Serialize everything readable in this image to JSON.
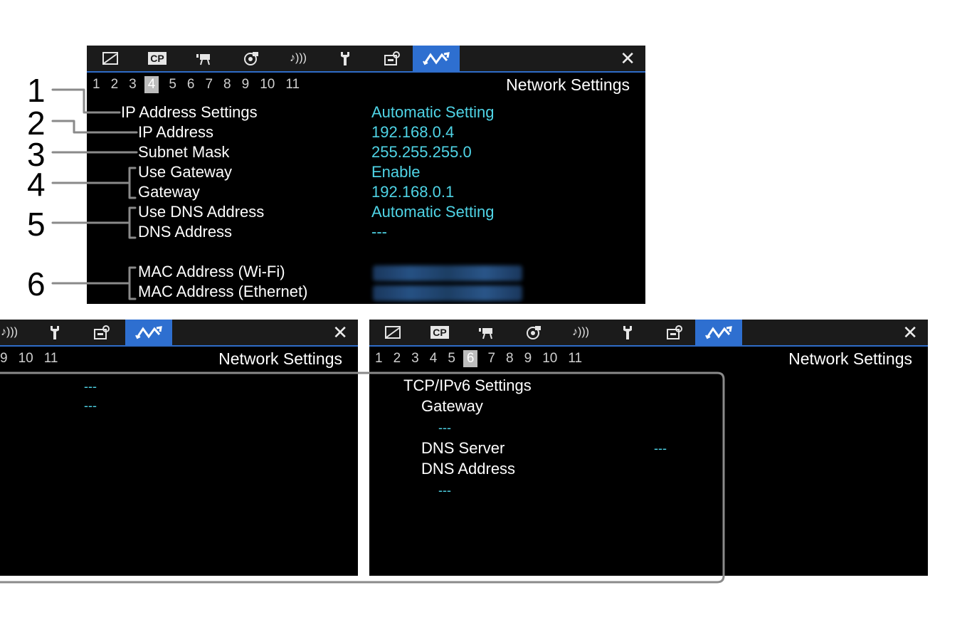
{
  "top_screen": {
    "tabs": [
      {
        "name": "camera-setup-tab",
        "icon": "camera-setup-icon"
      },
      {
        "name": "custom-picture-tab",
        "icon": "custom-picture-icon",
        "text": "CP"
      },
      {
        "name": "recording-setup-tab",
        "icon": "recording-icon"
      },
      {
        "name": "assistance-functions-tab",
        "icon": "assistance-icon"
      },
      {
        "name": "audio-setup-tab",
        "icon": "audio-icon",
        "text": "♪)))"
      },
      {
        "name": "system-setup-tab",
        "icon": "wrench-icon"
      },
      {
        "name": "my-menu-tab",
        "icon": "my-menu-icon"
      },
      {
        "name": "network-settings-tab",
        "icon": "network-icon",
        "active": true
      }
    ],
    "close_label": "✕",
    "pages": [
      "1",
      "2",
      "3",
      "4",
      "5",
      "6",
      "7",
      "8",
      "9",
      "10",
      "11"
    ],
    "selected_page": "4",
    "title": "Network Settings",
    "rows": {
      "ip_address_settings": {
        "label": "IP Address Settings",
        "value": "Automatic Setting"
      },
      "ip_address": {
        "label": "IP Address",
        "value": "192.168.0.4"
      },
      "subnet_mask": {
        "label": "Subnet Mask",
        "value": "255.255.255.0"
      },
      "use_gateway": {
        "label": "Use Gateway",
        "value": "Enable"
      },
      "gateway": {
        "label": "Gateway",
        "value": "192.168.0.1"
      },
      "use_dns_address": {
        "label": "Use DNS Address",
        "value": "Automatic Setting"
      },
      "dns_address": {
        "label": "DNS Address",
        "value": "---"
      },
      "mac_wifi": {
        "label": "MAC Address (Wi-Fi)"
      },
      "mac_ethernet": {
        "label": "MAC Address (Ethernet)"
      }
    }
  },
  "callouts": [
    "1",
    "2",
    "3",
    "4",
    "5",
    "6"
  ],
  "left_screen": {
    "tabs": [
      {
        "name": "audio-setup-tab",
        "icon": "audio-icon",
        "text": "♪)))"
      },
      {
        "name": "system-setup-tab",
        "icon": "wrench-icon"
      },
      {
        "name": "my-menu-tab",
        "icon": "my-menu-icon"
      },
      {
        "name": "network-settings-tab",
        "icon": "network-icon",
        "active": true
      }
    ],
    "close_label": "✕",
    "pages": [
      "9",
      "10",
      "11"
    ],
    "title": "Network Settings",
    "values": [
      "---",
      "---"
    ]
  },
  "right_screen": {
    "tabs": [
      {
        "name": "camera-setup-tab",
        "icon": "camera-setup-icon"
      },
      {
        "name": "custom-picture-tab",
        "icon": "custom-picture-icon",
        "text": "CP"
      },
      {
        "name": "recording-setup-tab",
        "icon": "recording-icon"
      },
      {
        "name": "assistance-functions-tab",
        "icon": "assistance-icon"
      },
      {
        "name": "audio-setup-tab",
        "icon": "audio-icon",
        "text": "♪)))"
      },
      {
        "name": "system-setup-tab",
        "icon": "wrench-icon"
      },
      {
        "name": "my-menu-tab",
        "icon": "my-menu-icon"
      },
      {
        "name": "network-settings-tab",
        "icon": "network-icon",
        "active": true
      }
    ],
    "close_label": "✕",
    "pages": [
      "1",
      "2",
      "3",
      "4",
      "5",
      "6",
      "7",
      "8",
      "9",
      "10",
      "11"
    ],
    "selected_page": "6",
    "title": "Network Settings",
    "tcp_ipv6_settings": "TCP/IPv6 Settings",
    "gateway_label": "Gateway",
    "gateway_value": "---",
    "dns_server_label": "DNS Server",
    "dns_server_value": "---",
    "dns_address_label": "DNS Address",
    "dns_address_value": "---"
  },
  "colors": {
    "screen_bg": "#000000",
    "tabbar_bg": "#1b1b1b",
    "active_tab": "#2e6fd0",
    "value_text": "#4fd4e6",
    "label_text": "#ffffff",
    "bracket_lines": "#888888"
  }
}
